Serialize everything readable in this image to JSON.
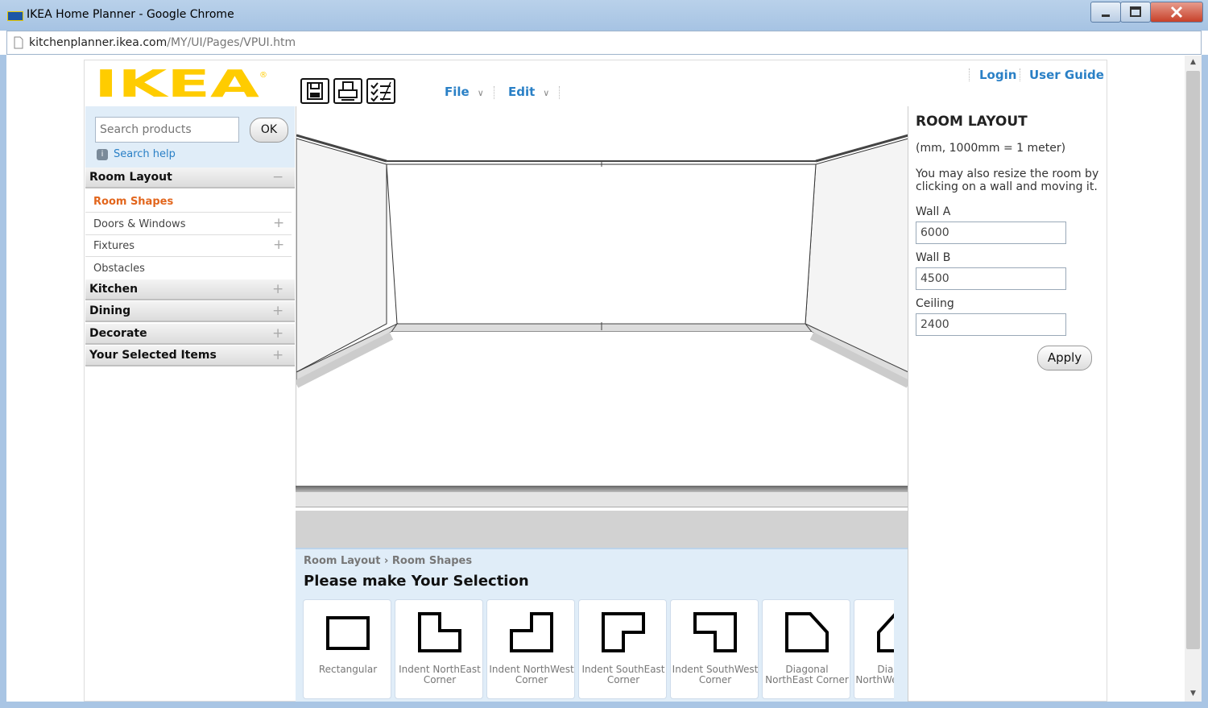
{
  "window": {
    "title": "IKEA Home Planner - Google Chrome",
    "url_host": "kitchenplanner.ikea.com",
    "url_path": "/MY/UI/Pages/VPUI.htm"
  },
  "header": {
    "logo": "IKEA",
    "menus": [
      "File",
      "Edit"
    ],
    "links": [
      "Login",
      "User Guide"
    ]
  },
  "search": {
    "placeholder": "Search products",
    "ok_label": "OK",
    "help_label": "Search help"
  },
  "sidebar": {
    "sections": [
      {
        "label": "Room Layout",
        "toggle": "−"
      },
      {
        "label": "Kitchen",
        "toggle": "+"
      },
      {
        "label": "Dining",
        "toggle": "+"
      },
      {
        "label": "Decorate",
        "toggle": "+"
      },
      {
        "label": "Your Selected Items",
        "toggle": "+"
      }
    ],
    "room_layout_items": [
      {
        "label": "Room Shapes",
        "toggle": ""
      },
      {
        "label": "Doors & Windows",
        "toggle": "+"
      },
      {
        "label": "Fixtures",
        "toggle": "+"
      },
      {
        "label": "Obstacles",
        "toggle": ""
      }
    ]
  },
  "selection": {
    "breadcrumb": [
      "Room Layout",
      "Room Shapes"
    ],
    "title": "Please make Your Selection",
    "shapes": [
      {
        "label": "Rectangular",
        "icon": "rectangular-shape-icon"
      },
      {
        "label": "Indent NorthEast Corner",
        "icon": "indent-northeast-shape-icon"
      },
      {
        "label": "Indent NorthWest Corner",
        "icon": "indent-northwest-shape-icon"
      },
      {
        "label": "Indent SouthEast Corner",
        "icon": "indent-southeast-shape-icon"
      },
      {
        "label": "Indent SouthWest Corner",
        "icon": "indent-southwest-shape-icon"
      },
      {
        "label": "Diagonal NorthEast Corner",
        "icon": "diagonal-northeast-shape-icon"
      },
      {
        "label": "Diagonal NorthWest Corner",
        "icon": "diagonal-northwest-shape-icon"
      }
    ]
  },
  "room_layout": {
    "title": "ROOM LAYOUT",
    "units": "(mm, 1000mm = 1 meter)",
    "hint": "You may also resize the room by clicking on a wall and moving it.",
    "fields": [
      {
        "label": "Wall A",
        "value": "6000"
      },
      {
        "label": "Wall B",
        "value": "4500"
      },
      {
        "label": "Ceiling",
        "value": "2400"
      }
    ],
    "apply_label": "Apply"
  },
  "colors": {
    "ikea_yellow": "#FFCC00",
    "link_blue": "#2a80c6",
    "active_orange": "#e2661d",
    "panel_blue": "#e0edf8"
  }
}
